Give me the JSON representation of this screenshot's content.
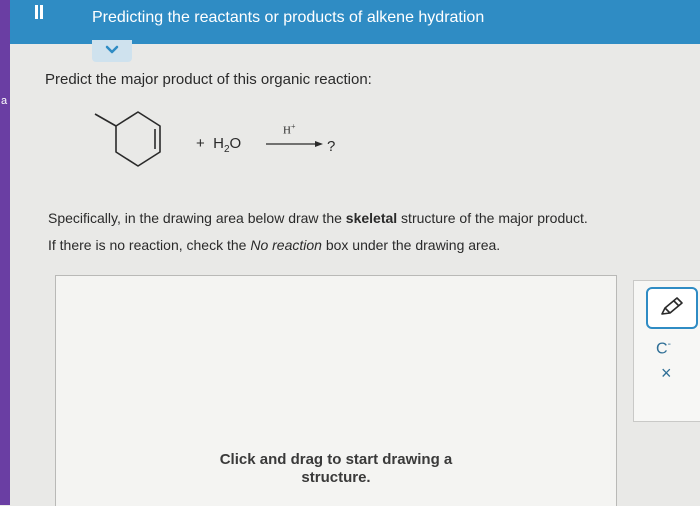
{
  "header": {
    "title": "Predicting the reactants or products of alkene hydration"
  },
  "question": {
    "prompt": "Predict the major product of this organic reaction:",
    "plus": "+",
    "reagent_main": "H",
    "reagent_sub": "2",
    "reagent_tail": "O",
    "catalyst": "H",
    "catalyst_sup": "+",
    "product": "?"
  },
  "instructions": {
    "line1_a": "Specifically, in the drawing area below draw the ",
    "line1_bold": "skeletal",
    "line1_b": " structure of the major product.",
    "line2_a": "If there is no reaction, check the ",
    "line2_italic": "No reaction",
    "line2_b": " box under the drawing area."
  },
  "canvas": {
    "hint_line1": "Click and drag to start drawing a",
    "hint_line2": "structure."
  },
  "toolbar": {
    "charge_label": "C",
    "charge_sup": "-",
    "close_label": "×"
  },
  "sidebar": {
    "edge_letter": "a"
  },
  "icons": [
    "menu-icon",
    "chevron-down-icon",
    "pencil-icon",
    "close-icon"
  ],
  "colors": {
    "header": "#2f8cc4",
    "left_strip": "#6a3ea3"
  }
}
